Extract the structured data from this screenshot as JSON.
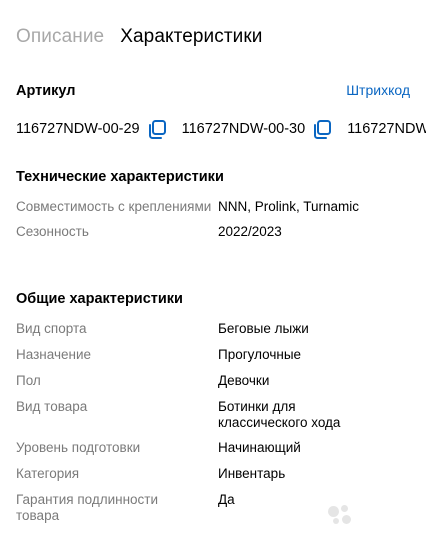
{
  "tabs": [
    {
      "label": "Описание",
      "active": false
    },
    {
      "label": "Характеристики",
      "active": true
    }
  ],
  "sku": {
    "title": "Артикул",
    "barcode_link": "Штрихкод",
    "codes": [
      "116727NDW-00-29",
      "116727NDW-00-30",
      "116727NDW"
    ]
  },
  "tech": {
    "title": "Технические характеристики",
    "rows": [
      {
        "label": "Совместимость с креплениями",
        "value": "NNN, Prolink, Turnamic"
      },
      {
        "label": "Сезонность",
        "value": "2022/2023"
      }
    ]
  },
  "general": {
    "title": "Общие характеристики",
    "rows": [
      {
        "label": "Вид спорта",
        "value": "Беговые лыжи"
      },
      {
        "label": "Назначение",
        "value": "Прогулочные"
      },
      {
        "label": "Пол",
        "value": "Девочки"
      },
      {
        "label": "Вид товара",
        "value": "Ботинки для классического хода"
      },
      {
        "label": "Уровень подготовки",
        "value": "Начинающий"
      },
      {
        "label": "Категория",
        "value": "Инвентарь"
      },
      {
        "label": "Гарантия подлинности товара",
        "value": "Да"
      }
    ]
  },
  "watermark": {
    "text": "Avito"
  },
  "colors": {
    "link": "#0a66c2",
    "copy_icon": "#0a66c2",
    "label": "#7a7a7a",
    "inactive_tab": "#a8a8a8"
  }
}
